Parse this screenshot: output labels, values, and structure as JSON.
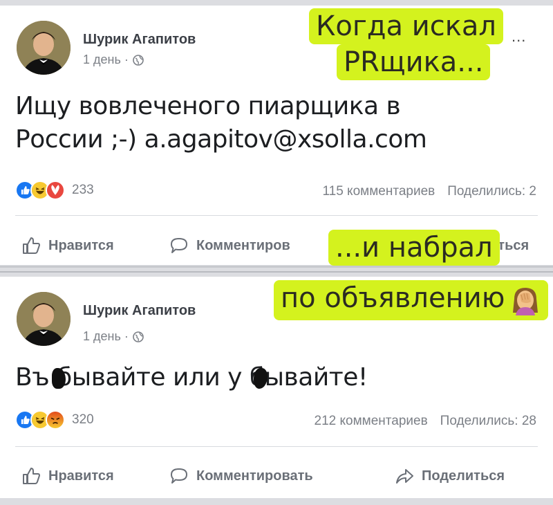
{
  "post1": {
    "author": "Шурик Агапитов",
    "time": "1 день ·",
    "text_line1": "Ищу вовлеченого пиарщика в",
    "text_line2": "России ;-) a.agapitov@xsolla.com",
    "reactions_count": "233",
    "comments": "115 комментариев",
    "shares": "Поделились: 2",
    "like_label": "Нравится",
    "comment_label": "Комментиров",
    "share_label": "иться"
  },
  "post2": {
    "author": "Шурик Агапитов",
    "time": "1 день ·",
    "text": "Въ бывайте или у бывайте!",
    "reactions_count": "320",
    "comments": "212 комментариев",
    "shares": "Поделились: 28",
    "like_label": "Нравится",
    "comment_label": "Комментировать",
    "share_label": "Поделиться"
  },
  "overlays": {
    "caption1_line1": "Когда искал",
    "caption1_line2": "PRщика...",
    "caption1_dots": "...",
    "caption2": "...и набрал",
    "caption3": "по объявлению",
    "facepalm_emoji": "facepalm-icon"
  },
  "colors": {
    "highlight": "#d4f21e",
    "like_blue": "#1877f2",
    "haha_yellow": "#f7c931",
    "angry_orange": "#e9710f"
  }
}
